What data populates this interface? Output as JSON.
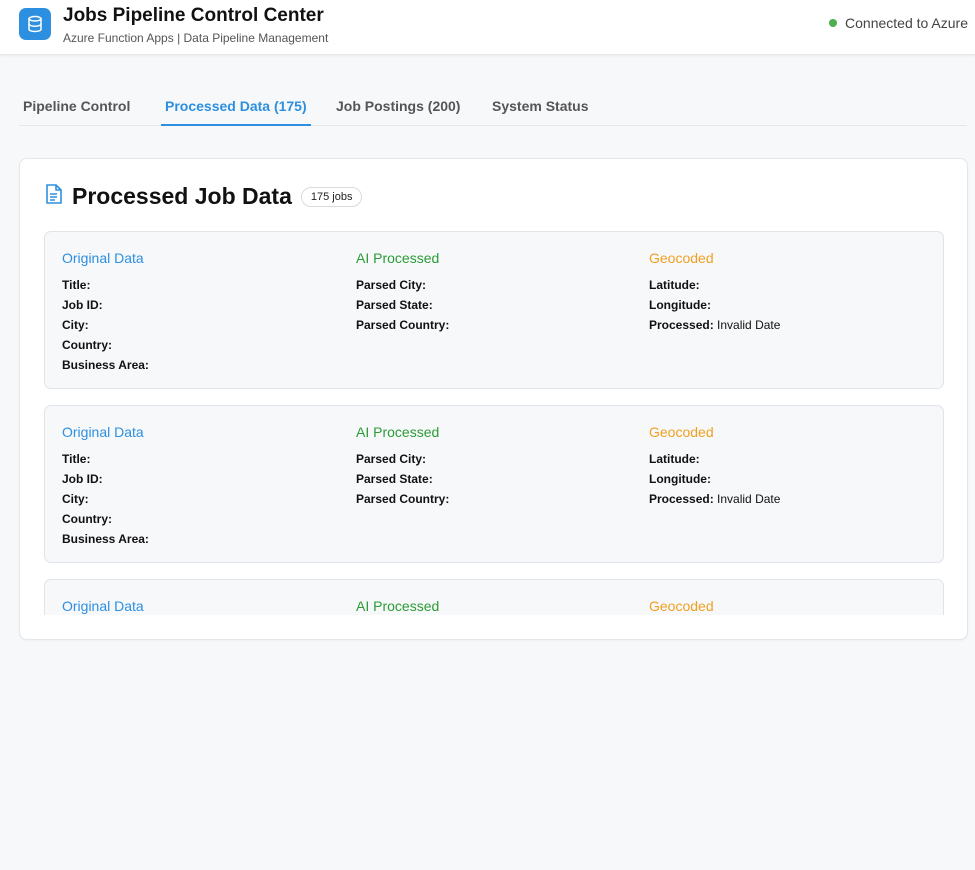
{
  "header": {
    "title": "Jobs Pipeline Control Center",
    "subtitle": "Azure Function Apps | Data Pipeline Management",
    "status_text": "Connected to Azure",
    "status_color": "#4caf50",
    "logo_icon": "database-icon",
    "accent_color": "#2d8fe0"
  },
  "tabs": [
    {
      "label": "Pipeline Control",
      "active": false
    },
    {
      "label": "Processed Data (175)",
      "active": true
    },
    {
      "label": "Job Postings (200)",
      "active": false
    },
    {
      "label": "System Status",
      "active": false
    }
  ],
  "panel": {
    "icon": "document-icon",
    "title": "Processed Job Data",
    "badge": "175 jobs"
  },
  "jobs": [
    {
      "original": {
        "heading": "Original Data",
        "fields": [
          {
            "label": "Title:",
            "value": ""
          },
          {
            "label": "Job ID:",
            "value": ""
          },
          {
            "label": "City:",
            "value": ""
          },
          {
            "label": "Country:",
            "value": ""
          },
          {
            "label": "Business Area:",
            "value": ""
          }
        ]
      },
      "ai": {
        "heading": "AI Processed",
        "fields": [
          {
            "label": "Parsed City:",
            "value": ""
          },
          {
            "label": "Parsed State:",
            "value": ""
          },
          {
            "label": "Parsed Country:",
            "value": ""
          }
        ]
      },
      "geo": {
        "heading": "Geocoded",
        "fields": [
          {
            "label": "Latitude:",
            "value": ""
          },
          {
            "label": "Longitude:",
            "value": ""
          },
          {
            "label": "Processed:",
            "value": "Invalid Date"
          }
        ]
      }
    },
    {
      "original": {
        "heading": "Original Data",
        "fields": [
          {
            "label": "Title:",
            "value": ""
          },
          {
            "label": "Job ID:",
            "value": ""
          },
          {
            "label": "City:",
            "value": ""
          },
          {
            "label": "Country:",
            "value": ""
          },
          {
            "label": "Business Area:",
            "value": ""
          }
        ]
      },
      "ai": {
        "heading": "AI Processed",
        "fields": [
          {
            "label": "Parsed City:",
            "value": ""
          },
          {
            "label": "Parsed State:",
            "value": ""
          },
          {
            "label": "Parsed Country:",
            "value": ""
          }
        ]
      },
      "geo": {
        "heading": "Geocoded",
        "fields": [
          {
            "label": "Latitude:",
            "value": ""
          },
          {
            "label": "Longitude:",
            "value": ""
          },
          {
            "label": "Processed:",
            "value": "Invalid Date"
          }
        ]
      }
    },
    {
      "original": {
        "heading": "Original Data",
        "fields": []
      },
      "ai": {
        "heading": "AI Processed",
        "fields": []
      },
      "geo": {
        "heading": "Geocoded",
        "fields": []
      }
    }
  ]
}
